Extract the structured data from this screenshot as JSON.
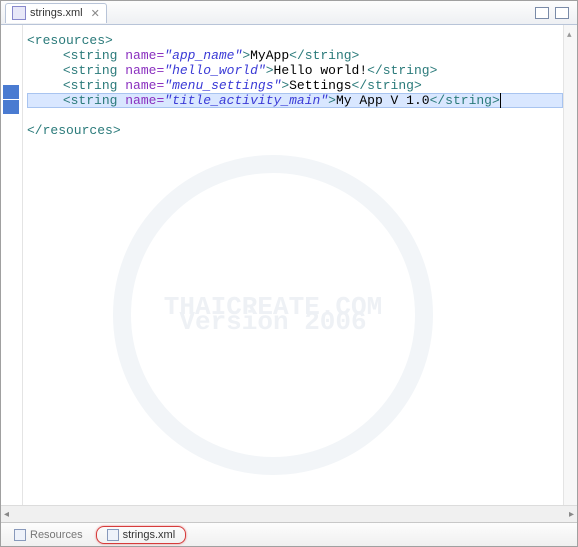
{
  "tab": {
    "title": "strings.xml",
    "close_glyph": "✕"
  },
  "toolbar": {
    "minimize": "min",
    "maximize": "max"
  },
  "code": {
    "root_open": "<resources>",
    "root_close": "</resources>",
    "lines": [
      {
        "tag_open": "<string",
        "attr": "name",
        "val": "app_name",
        "gt": ">",
        "text": "MyApp",
        "tag_close": "</string>"
      },
      {
        "tag_open": "<string",
        "attr": "name",
        "val": "hello_world",
        "gt": ">",
        "text": "Hello world!",
        "tag_close": "</string>"
      },
      {
        "tag_open": "<string",
        "attr": "name",
        "val": "menu_settings",
        "gt": ">",
        "text": "Settings",
        "tag_close": "</string>"
      },
      {
        "tag_open": "<string",
        "attr": "name",
        "val": "title_activity_main",
        "gt": ">",
        "text": "My App V 1.0",
        "tag_close": "</string>"
      }
    ]
  },
  "watermark": {
    "line1": "THAICREATE.COM",
    "line2": "Version 2006"
  },
  "bottom_tabs": {
    "resources": "Resources",
    "strings": "strings.xml"
  }
}
